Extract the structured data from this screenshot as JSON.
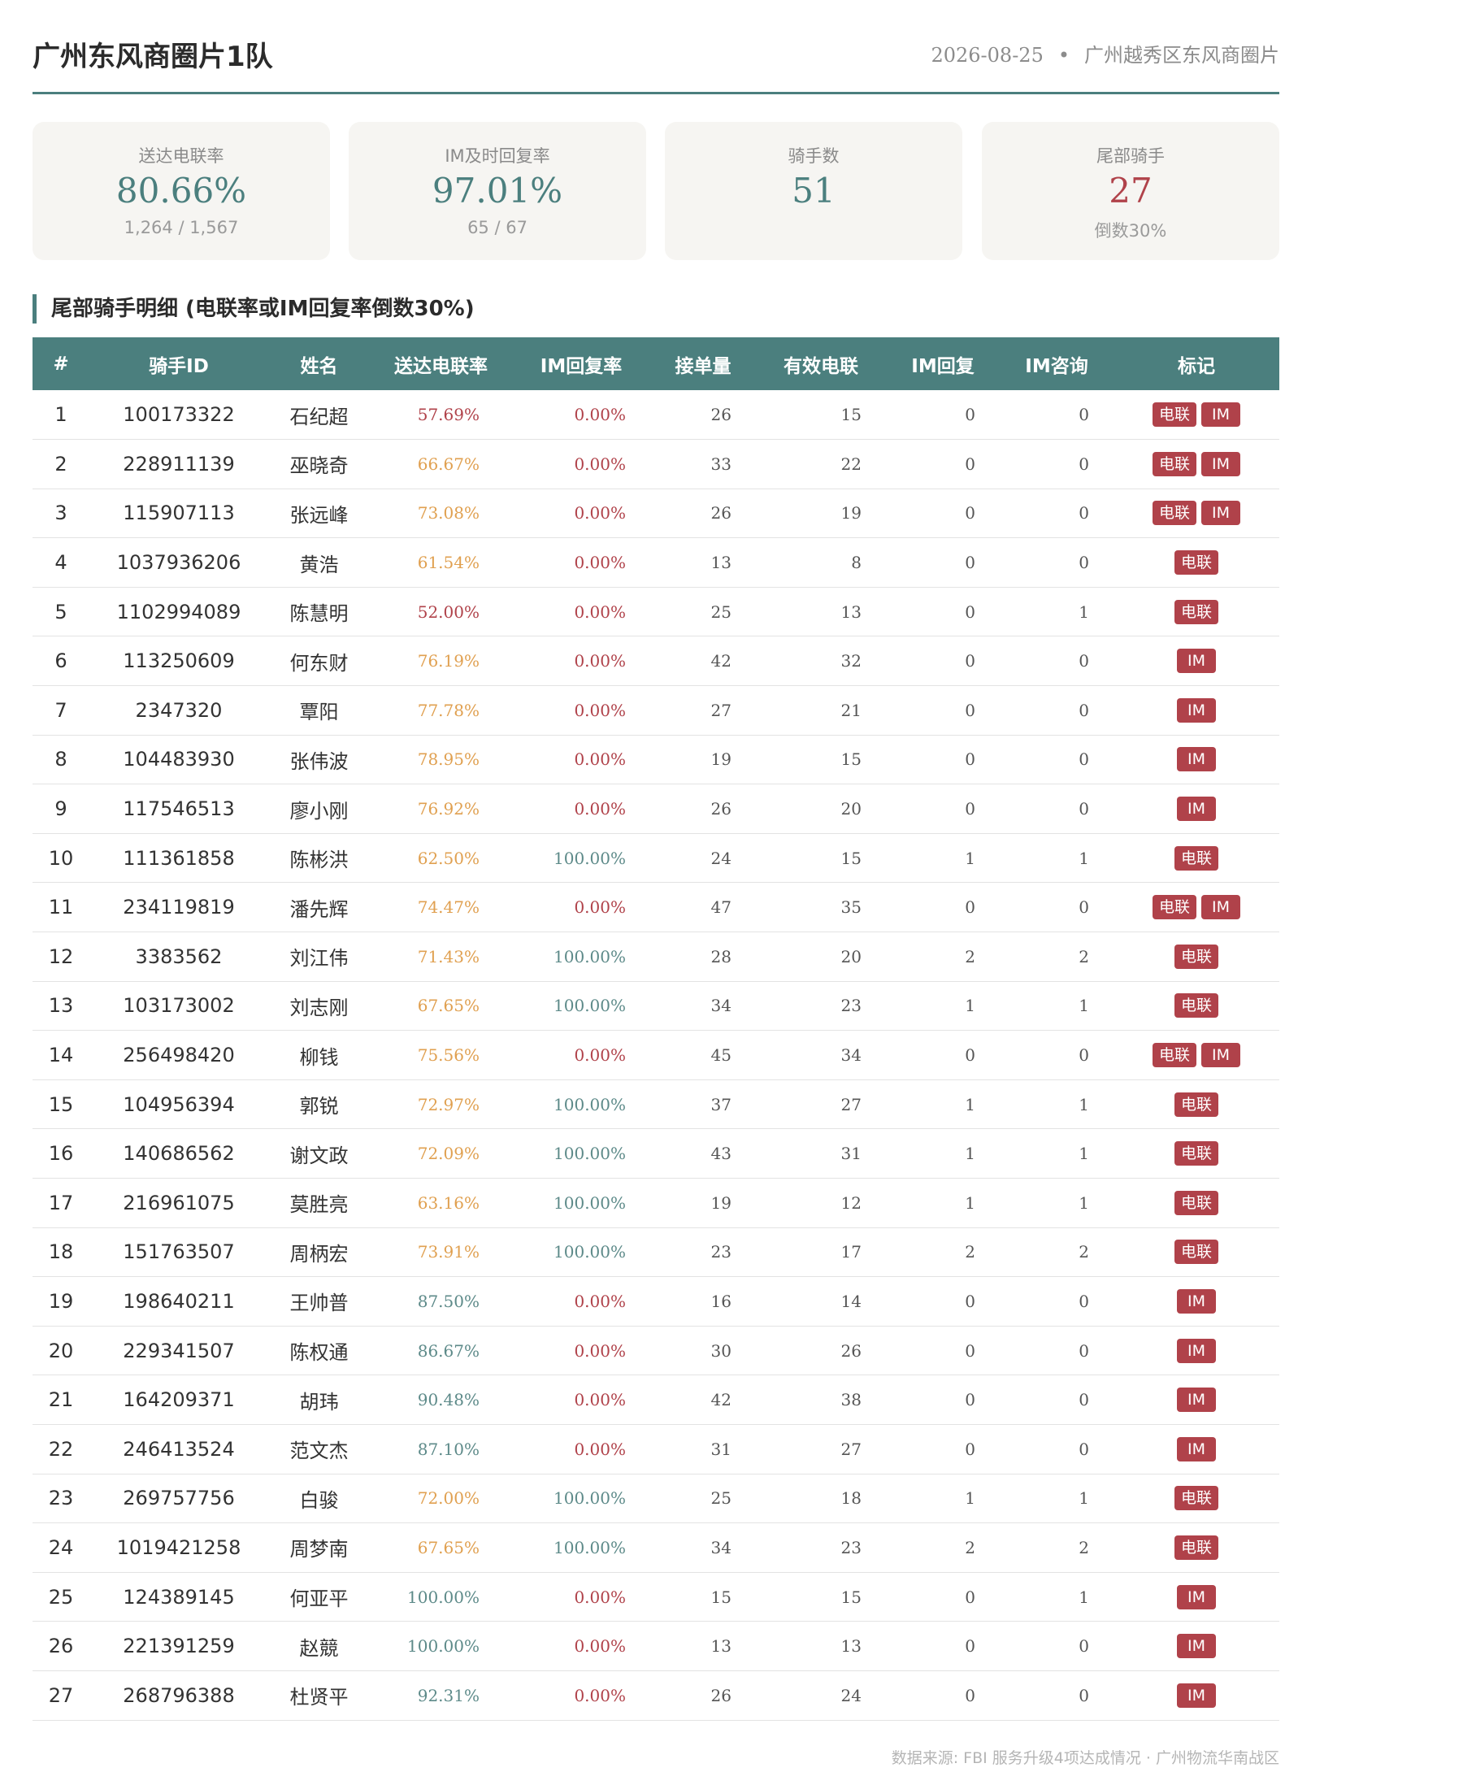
{
  "header": {
    "title": "广州东风商圈片1队",
    "date": "2026-08-25",
    "separator": "•",
    "area": "广州越秀区东风商圈片"
  },
  "cards": [
    {
      "label": "送达电联率",
      "value": "80.66%",
      "sub": "1,264 / 1,567",
      "color": "#4b7f7e"
    },
    {
      "label": "IM及时回复率",
      "value": "97.01%",
      "sub": "65 / 67",
      "color": "#4b7f7e"
    },
    {
      "label": "骑手数",
      "value": "51",
      "sub": "",
      "color": "#4b7f7e"
    },
    {
      "label": "尾部骑手",
      "value": "27",
      "sub": "倒数30%",
      "color": "#b0424a"
    }
  ],
  "section_title": "尾部骑手明细 (电联率或IM回复率倒数30%)",
  "table": {
    "headers": [
      "#",
      "骑手ID",
      "姓名",
      "送达电联率",
      "IM回复率",
      "接单量",
      "有效电联",
      "IM回复",
      "IM咨询",
      "标记"
    ],
    "tag_labels": {
      "call": "电联",
      "im": "IM"
    },
    "rows": [
      {
        "idx": "1",
        "id": "100173322",
        "name": "石纪超",
        "call_rate": "57.69%",
        "im_rate": "0.00%",
        "orders": "26",
        "valid_calls": "15",
        "im_reply": "0",
        "im_consult": "0",
        "tag_call": true,
        "tag_im": true
      },
      {
        "idx": "2",
        "id": "228911139",
        "name": "巫晓奇",
        "call_rate": "66.67%",
        "im_rate": "0.00%",
        "orders": "33",
        "valid_calls": "22",
        "im_reply": "0",
        "im_consult": "0",
        "tag_call": true,
        "tag_im": true
      },
      {
        "idx": "3",
        "id": "115907113",
        "name": "张远峰",
        "call_rate": "73.08%",
        "im_rate": "0.00%",
        "orders": "26",
        "valid_calls": "19",
        "im_reply": "0",
        "im_consult": "0",
        "tag_call": true,
        "tag_im": true
      },
      {
        "idx": "4",
        "id": "1037936206",
        "name": "黄浩",
        "call_rate": "61.54%",
        "im_rate": "0.00%",
        "orders": "13",
        "valid_calls": "8",
        "im_reply": "0",
        "im_consult": "0",
        "tag_call": true,
        "tag_im": false
      },
      {
        "idx": "5",
        "id": "1102994089",
        "name": "陈慧明",
        "call_rate": "52.00%",
        "im_rate": "0.00%",
        "orders": "25",
        "valid_calls": "13",
        "im_reply": "0",
        "im_consult": "1",
        "tag_call": true,
        "tag_im": false
      },
      {
        "idx": "6",
        "id": "113250609",
        "name": "何东财",
        "call_rate": "76.19%",
        "im_rate": "0.00%",
        "orders": "42",
        "valid_calls": "32",
        "im_reply": "0",
        "im_consult": "0",
        "tag_call": false,
        "tag_im": true
      },
      {
        "idx": "7",
        "id": "2347320",
        "name": "覃阳",
        "call_rate": "77.78%",
        "im_rate": "0.00%",
        "orders": "27",
        "valid_calls": "21",
        "im_reply": "0",
        "im_consult": "0",
        "tag_call": false,
        "tag_im": true
      },
      {
        "idx": "8",
        "id": "104483930",
        "name": "张伟波",
        "call_rate": "78.95%",
        "im_rate": "0.00%",
        "orders": "19",
        "valid_calls": "15",
        "im_reply": "0",
        "im_consult": "0",
        "tag_call": false,
        "tag_im": true
      },
      {
        "idx": "9",
        "id": "117546513",
        "name": "廖小刚",
        "call_rate": "76.92%",
        "im_rate": "0.00%",
        "orders": "26",
        "valid_calls": "20",
        "im_reply": "0",
        "im_consult": "0",
        "tag_call": false,
        "tag_im": true
      },
      {
        "idx": "10",
        "id": "111361858",
        "name": "陈彬洪",
        "call_rate": "62.50%",
        "im_rate": "100.00%",
        "orders": "24",
        "valid_calls": "15",
        "im_reply": "1",
        "im_consult": "1",
        "tag_call": true,
        "tag_im": false
      },
      {
        "idx": "11",
        "id": "234119819",
        "name": "潘先辉",
        "call_rate": "74.47%",
        "im_rate": "0.00%",
        "orders": "47",
        "valid_calls": "35",
        "im_reply": "0",
        "im_consult": "0",
        "tag_call": true,
        "tag_im": true
      },
      {
        "idx": "12",
        "id": "3383562",
        "name": "刘江伟",
        "call_rate": "71.43%",
        "im_rate": "100.00%",
        "orders": "28",
        "valid_calls": "20",
        "im_reply": "2",
        "im_consult": "2",
        "tag_call": true,
        "tag_im": false
      },
      {
        "idx": "13",
        "id": "103173002",
        "name": "刘志刚",
        "call_rate": "67.65%",
        "im_rate": "100.00%",
        "orders": "34",
        "valid_calls": "23",
        "im_reply": "1",
        "im_consult": "1",
        "tag_call": true,
        "tag_im": false
      },
      {
        "idx": "14",
        "id": "256498420",
        "name": "柳钱",
        "call_rate": "75.56%",
        "im_rate": "0.00%",
        "orders": "45",
        "valid_calls": "34",
        "im_reply": "0",
        "im_consult": "0",
        "tag_call": true,
        "tag_im": true
      },
      {
        "idx": "15",
        "id": "104956394",
        "name": "郭锐",
        "call_rate": "72.97%",
        "im_rate": "100.00%",
        "orders": "37",
        "valid_calls": "27",
        "im_reply": "1",
        "im_consult": "1",
        "tag_call": true,
        "tag_im": false
      },
      {
        "idx": "16",
        "id": "140686562",
        "name": "谢文政",
        "call_rate": "72.09%",
        "im_rate": "100.00%",
        "orders": "43",
        "valid_calls": "31",
        "im_reply": "1",
        "im_consult": "1",
        "tag_call": true,
        "tag_im": false
      },
      {
        "idx": "17",
        "id": "216961075",
        "name": "莫胜亮",
        "call_rate": "63.16%",
        "im_rate": "100.00%",
        "orders": "19",
        "valid_calls": "12",
        "im_reply": "1",
        "im_consult": "1",
        "tag_call": true,
        "tag_im": false
      },
      {
        "idx": "18",
        "id": "151763507",
        "name": "周柄宏",
        "call_rate": "73.91%",
        "im_rate": "100.00%",
        "orders": "23",
        "valid_calls": "17",
        "im_reply": "2",
        "im_consult": "2",
        "tag_call": true,
        "tag_im": false
      },
      {
        "idx": "19",
        "id": "198640211",
        "name": "王帅普",
        "call_rate": "87.50%",
        "im_rate": "0.00%",
        "orders": "16",
        "valid_calls": "14",
        "im_reply": "0",
        "im_consult": "0",
        "tag_call": false,
        "tag_im": true
      },
      {
        "idx": "20",
        "id": "229341507",
        "name": "陈权通",
        "call_rate": "86.67%",
        "im_rate": "0.00%",
        "orders": "30",
        "valid_calls": "26",
        "im_reply": "0",
        "im_consult": "0",
        "tag_call": false,
        "tag_im": true
      },
      {
        "idx": "21",
        "id": "164209371",
        "name": "胡玮",
        "call_rate": "90.48%",
        "im_rate": "0.00%",
        "orders": "42",
        "valid_calls": "38",
        "im_reply": "0",
        "im_consult": "0",
        "tag_call": false,
        "tag_im": true
      },
      {
        "idx": "22",
        "id": "246413524",
        "name": "范文杰",
        "call_rate": "87.10%",
        "im_rate": "0.00%",
        "orders": "31",
        "valid_calls": "27",
        "im_reply": "0",
        "im_consult": "0",
        "tag_call": false,
        "tag_im": true
      },
      {
        "idx": "23",
        "id": "269757756",
        "name": "白骏",
        "call_rate": "72.00%",
        "im_rate": "100.00%",
        "orders": "25",
        "valid_calls": "18",
        "im_reply": "1",
        "im_consult": "1",
        "tag_call": true,
        "tag_im": false
      },
      {
        "idx": "24",
        "id": "1019421258",
        "name": "周梦南",
        "call_rate": "67.65%",
        "im_rate": "100.00%",
        "orders": "34",
        "valid_calls": "23",
        "im_reply": "2",
        "im_consult": "2",
        "tag_call": true,
        "tag_im": false
      },
      {
        "idx": "25",
        "id": "124389145",
        "name": "何亚平",
        "call_rate": "100.00%",
        "im_rate": "0.00%",
        "orders": "15",
        "valid_calls": "15",
        "im_reply": "0",
        "im_consult": "1",
        "tag_call": false,
        "tag_im": true
      },
      {
        "idx": "26",
        "id": "221391259",
        "name": "赵競",
        "call_rate": "100.00%",
        "im_rate": "0.00%",
        "orders": "13",
        "valid_calls": "13",
        "im_reply": "0",
        "im_consult": "0",
        "tag_call": false,
        "tag_im": true
      },
      {
        "idx": "27",
        "id": "268796388",
        "name": "杜贤平",
        "call_rate": "92.31%",
        "im_rate": "0.00%",
        "orders": "26",
        "valid_calls": "24",
        "im_reply": "0",
        "im_consult": "0",
        "tag_call": false,
        "tag_im": true
      }
    ]
  },
  "colors": {
    "accent": "#4b7f7e",
    "red": "#b0424a",
    "orange": "#e0a050",
    "teal_text": "#5d8a89",
    "card_bg": "#f6f5f2"
  },
  "footer": "数据来源: FBI 服务升级4项达成情况 · 广州物流华南战区"
}
